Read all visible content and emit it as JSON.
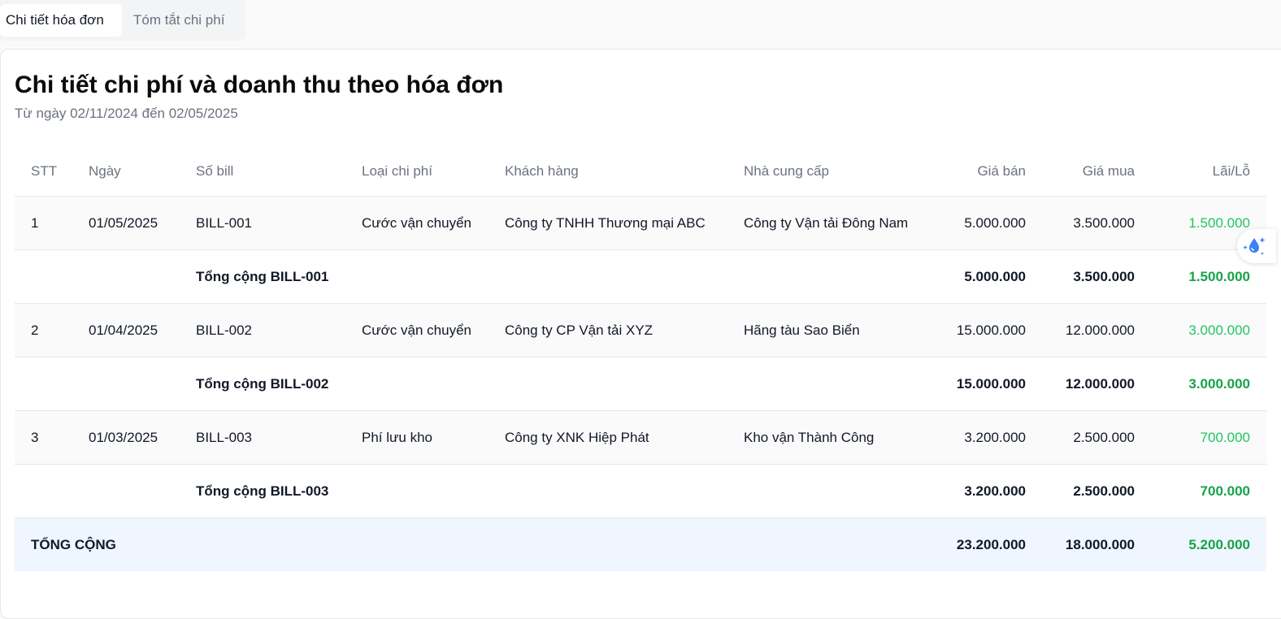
{
  "tabs": [
    {
      "label": "Chi tiết hóa đơn",
      "active": true
    },
    {
      "label": "Tóm tắt chi phí",
      "active": false
    }
  ],
  "report": {
    "title": "Chi tiết chi phí và doanh thu theo hóa đơn",
    "subtitle": "Từ ngày 02/11/2024 đến 02/05/2025"
  },
  "table": {
    "headers": {
      "stt": "STT",
      "date": "Ngày",
      "bill": "Số bill",
      "type": "Loại chi phí",
      "customer": "Khách hàng",
      "supplier": "Nhà cung cấp",
      "sell": "Giá bán",
      "buy": "Giá mua",
      "pl": "Lãi/Lỗ"
    },
    "rows": [
      {
        "stt": "1",
        "date": "01/05/2025",
        "bill": "BILL-001",
        "type": "Cước vận chuyển",
        "customer": "Công ty TNHH Thương mại ABC",
        "supplier": "Công ty Vận tải Đông Nam",
        "sell": "5.000.000",
        "buy": "3.500.000",
        "pl": "1.500.000",
        "subtotal": {
          "label": "Tổng cộng BILL-001",
          "sell": "5.000.000",
          "buy": "3.500.000",
          "pl": "1.500.000"
        }
      },
      {
        "stt": "2",
        "date": "01/04/2025",
        "bill": "BILL-002",
        "type": "Cước vận chuyển",
        "customer": "Công ty CP Vận tải XYZ",
        "supplier": "Hãng tàu Sao Biển",
        "sell": "15.000.000",
        "buy": "12.000.000",
        "pl": "3.000.000",
        "subtotal": {
          "label": "Tổng cộng BILL-002",
          "sell": "15.000.000",
          "buy": "12.000.000",
          "pl": "3.000.000"
        }
      },
      {
        "stt": "3",
        "date": "01/03/2025",
        "bill": "BILL-003",
        "type": "Phí lưu kho",
        "customer": "Công ty XNK Hiệp Phát",
        "supplier": "Kho vận Thành Công",
        "sell": "3.200.000",
        "buy": "2.500.000",
        "pl": "700.000",
        "subtotal": {
          "label": "Tổng cộng BILL-003",
          "sell": "3.200.000",
          "buy": "2.500.000",
          "pl": "700.000"
        }
      }
    ],
    "grand_total": {
      "label": "TỔNG CỘNG",
      "sell": "23.200.000",
      "buy": "18.000.000",
      "pl": "5.200.000"
    }
  },
  "floating_button": {
    "icon": "water-drop-sparkle-icon"
  },
  "colors": {
    "profit": "#22c55e",
    "grand_total_bg": "#eff6ff"
  }
}
